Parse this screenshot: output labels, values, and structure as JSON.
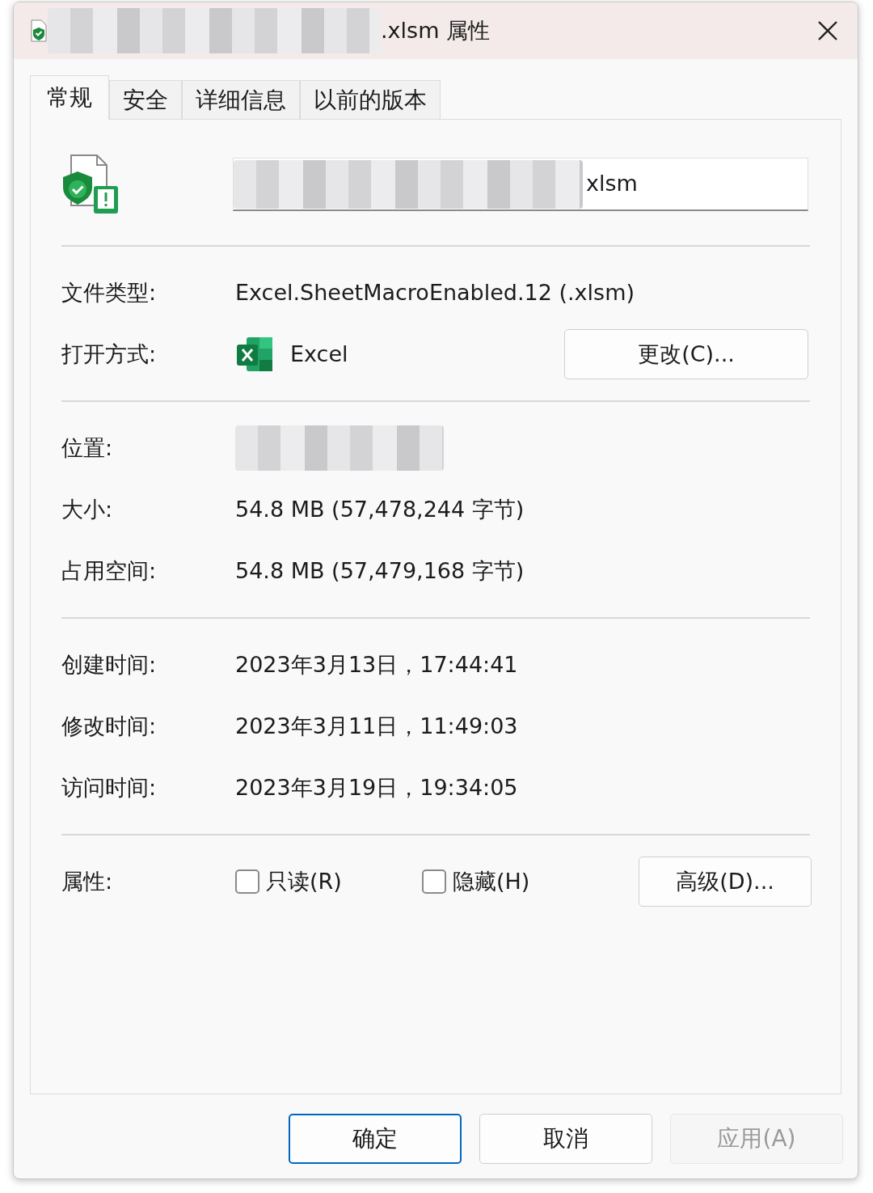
{
  "window": {
    "title": ".xlsm 属性"
  },
  "tabs": [
    {
      "label": "常规",
      "selected": true
    },
    {
      "label": "安全",
      "selected": false
    },
    {
      "label": "详细信息",
      "selected": false
    },
    {
      "label": "以前的版本",
      "selected": false
    }
  ],
  "file": {
    "name": "xlsm"
  },
  "type_row": {
    "label": "文件类型:",
    "value": "Excel.SheetMacroEnabled.12 (.xlsm)"
  },
  "open_with": {
    "label": "打开方式:",
    "app": "Excel",
    "button": "更改(C)..."
  },
  "location": {
    "label": "位置:"
  },
  "size_rows": [
    {
      "label": "大小:",
      "value": "54.8 MB (57,478,244 字节)"
    },
    {
      "label": "占用空间:",
      "value": "54.8 MB (57,479,168 字节)"
    }
  ],
  "time_rows": [
    {
      "label": "创建时间:",
      "value": "2023年3月13日，17:44:41"
    },
    {
      "label": "修改时间:",
      "value": "2023年3月11日，11:49:03"
    },
    {
      "label": "访问时间:",
      "value": "2023年3月19日，19:34:05"
    }
  ],
  "attributes": {
    "label": "属性:",
    "checkboxes": [
      {
        "label": "只读(R)",
        "checked": false
      },
      {
        "label": "隐藏(H)",
        "checked": false
      }
    ],
    "button": "高级(D)..."
  },
  "buttons": [
    {
      "label": "确定",
      "default": true,
      "disabled": false
    },
    {
      "label": "取消",
      "default": false,
      "disabled": false
    },
    {
      "label": "应用(A)",
      "default": false,
      "disabled": true
    }
  ]
}
